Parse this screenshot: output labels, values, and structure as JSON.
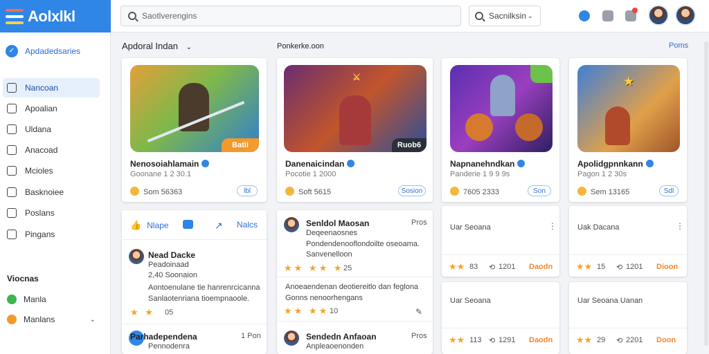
{
  "app": {
    "logo_text": "Aolxlkl",
    "search_placeholder": "Saotlverengins",
    "filter_label": "Sacnilksin",
    "brand_color": "#2f86e6"
  },
  "sidebar": {
    "top_label": "Apdadedsaries",
    "items": [
      {
        "label": "Nancoan",
        "icon": "home-icon"
      },
      {
        "label": "Apoalian",
        "icon": "user-icon"
      },
      {
        "label": "Uldana",
        "icon": "chart-icon"
      },
      {
        "label": "Anacoad",
        "icon": "folder-icon"
      },
      {
        "label": "Mcioles",
        "icon": "tag-icon"
      },
      {
        "label": "Basknoiee",
        "icon": "list-icon"
      },
      {
        "label": "Poslans",
        "icon": "doc-icon"
      },
      {
        "label": "Pingans",
        "icon": "gear-icon"
      }
    ],
    "section_title": "Viocnas",
    "sub_items": [
      {
        "label": "Manla",
        "color": "#3fb44f"
      },
      {
        "label": "Manlans",
        "color": "#f29a2e"
      }
    ]
  },
  "main": {
    "section_title": "Apdoral Indan",
    "section_sub": "Ponkerke.oon",
    "section_link": "Poms",
    "games": [
      {
        "title": "Nenosoiahlamain",
        "sub": "Goonane 1 2 30.1",
        "meta": "Som 56363",
        "pill": "lbl",
        "badge": "Batii"
      },
      {
        "title": "Danenaicindan",
        "sub": "Pocotie 1 2000",
        "meta": "Soft 5615",
        "pill": "Sosion",
        "badge": "Ruob6"
      },
      {
        "title": "Napnanehndkan",
        "sub": "Panderie 1 9 9 9s",
        "meta": "7605 2333",
        "pill": "Son",
        "badge": ""
      },
      {
        "title": "Apolidgpnnkann",
        "sub": "Pagon 1 2 30s",
        "meta": "Sem 13165",
        "pill": "Sdl",
        "badge": ""
      }
    ],
    "actions": [
      {
        "label": "Nlape",
        "icon": "like-icon"
      },
      {
        "label": "",
        "icon": "comment-icon"
      },
      {
        "label": "Nalcs",
        "icon": "share-icon"
      }
    ],
    "posts_left": [
      {
        "name": "Nead Dacke",
        "handle": "Peadoinaad",
        "text1": "2,40 Soonaion",
        "text2": "Aontoenulane tie hanrenrcicanna",
        "text3": "Sanlaotenriana tioempnaoole.",
        "rating": "05",
        "time": ""
      },
      {
        "name": "Parhadependena",
        "handle": "Pennodenra",
        "text1": "",
        "text2": "",
        "text3": "",
        "rating": "",
        "time": "1 Pon"
      }
    ],
    "posts_mid": [
      {
        "name": "Senldol Maosan",
        "handle": "Deqeenaosnes",
        "text1": "Pondendenooflondoilte oseoama.",
        "text2": "Sanvenelloon",
        "rating": "25",
        "time": "Pros"
      },
      {
        "name": "",
        "handle": "",
        "text1": "Anoeaendenan deotiereitlo dan feglona",
        "text2": "Gonns nenoorhengans",
        "rating": "10",
        "time": ""
      },
      {
        "name": "Sendedn Anfaoan",
        "handle": "Anpleaoenonden",
        "text1": "",
        "text2": "",
        "rating": "",
        "time": "Pros"
      }
    ],
    "list_cards": [
      {
        "title": "Uar Seoana",
        "stars": "83",
        "count": "1201",
        "link": "Daodn"
      },
      {
        "title": "Uak Dacana",
        "stars": "15",
        "count": "1201",
        "link": "Dioon"
      },
      {
        "title": "Uar Seoana",
        "stars": "113",
        "count": "1291",
        "link": "Daodn"
      },
      {
        "title": "Uar Seoana Uanan",
        "stars": "29",
        "count": "2201",
        "link": "Doon"
      }
    ]
  }
}
